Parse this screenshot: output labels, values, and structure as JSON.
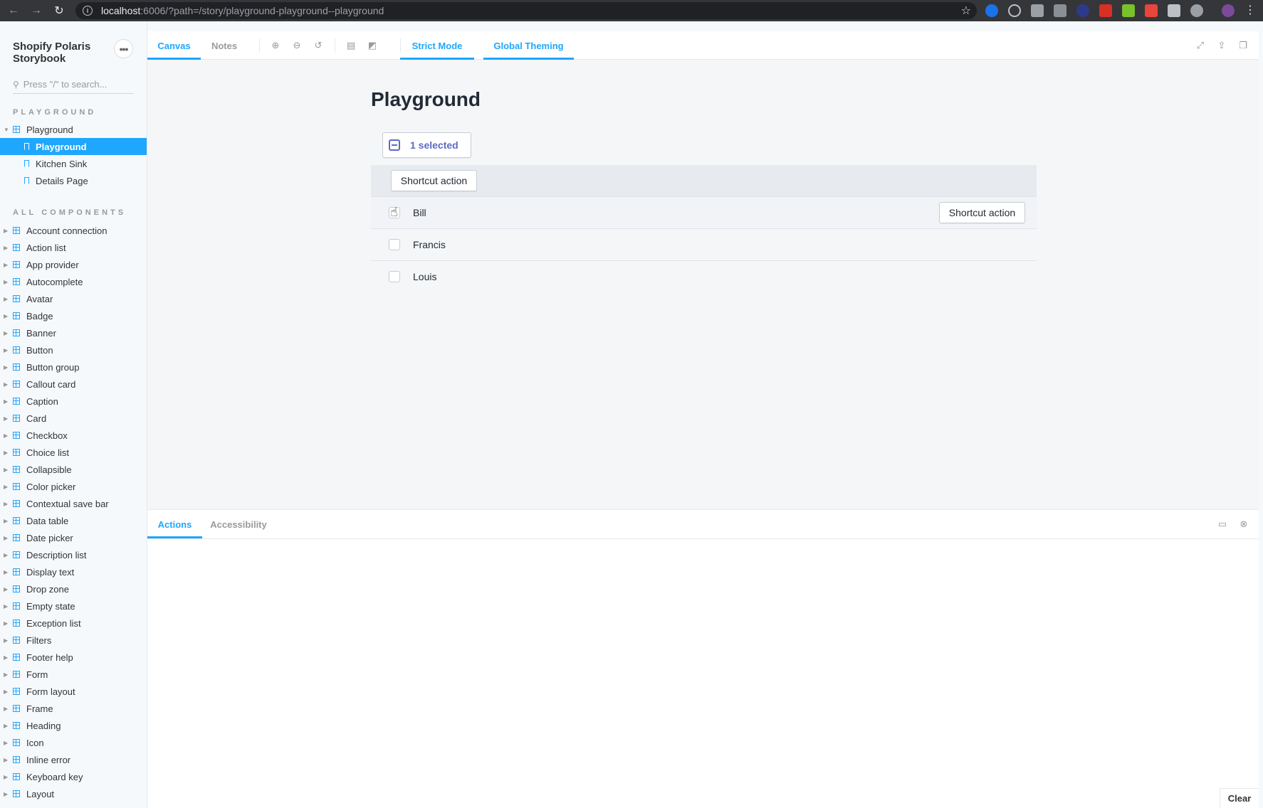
{
  "browser": {
    "url_host": "localhost",
    "url_rest": ":6006/?path=/story/playground-playground--playground"
  },
  "sidebar": {
    "brand": "Shopify Polaris Storybook",
    "search_placeholder": "Press \"/\" to search...",
    "section_playground": "PLAYGROUND",
    "section_all": "ALL COMPONENTS",
    "playground_group": "Playground",
    "stories": [
      {
        "label": "Playground",
        "selected": true
      },
      {
        "label": "Kitchen Sink",
        "selected": false
      },
      {
        "label": "Details Page",
        "selected": false
      }
    ],
    "components": [
      "Account connection",
      "Action list",
      "App provider",
      "Autocomplete",
      "Avatar",
      "Badge",
      "Banner",
      "Button",
      "Button group",
      "Callout card",
      "Caption",
      "Card",
      "Checkbox",
      "Choice list",
      "Collapsible",
      "Color picker",
      "Contextual save bar",
      "Data table",
      "Date picker",
      "Description list",
      "Display text",
      "Drop zone",
      "Empty state",
      "Exception list",
      "Filters",
      "Footer help",
      "Form",
      "Form layout",
      "Frame",
      "Heading",
      "Icon",
      "Inline error",
      "Keyboard key",
      "Layout"
    ]
  },
  "toolbar": {
    "canvas": "Canvas",
    "notes": "Notes",
    "strict_mode": "Strict Mode",
    "global_theming": "Global Theming"
  },
  "preview": {
    "title": "Playground",
    "bulk_label": "1 selected",
    "bulk_action": "Shortcut action",
    "rows": [
      {
        "name": "Bill",
        "action": "Shortcut action"
      },
      {
        "name": "Francis"
      },
      {
        "name": "Louis"
      }
    ]
  },
  "addons": {
    "actions": "Actions",
    "accessibility": "Accessibility",
    "clear": "Clear"
  },
  "colors": {
    "accent": "#1ea7fd",
    "indigo": "#5c6ac4"
  }
}
